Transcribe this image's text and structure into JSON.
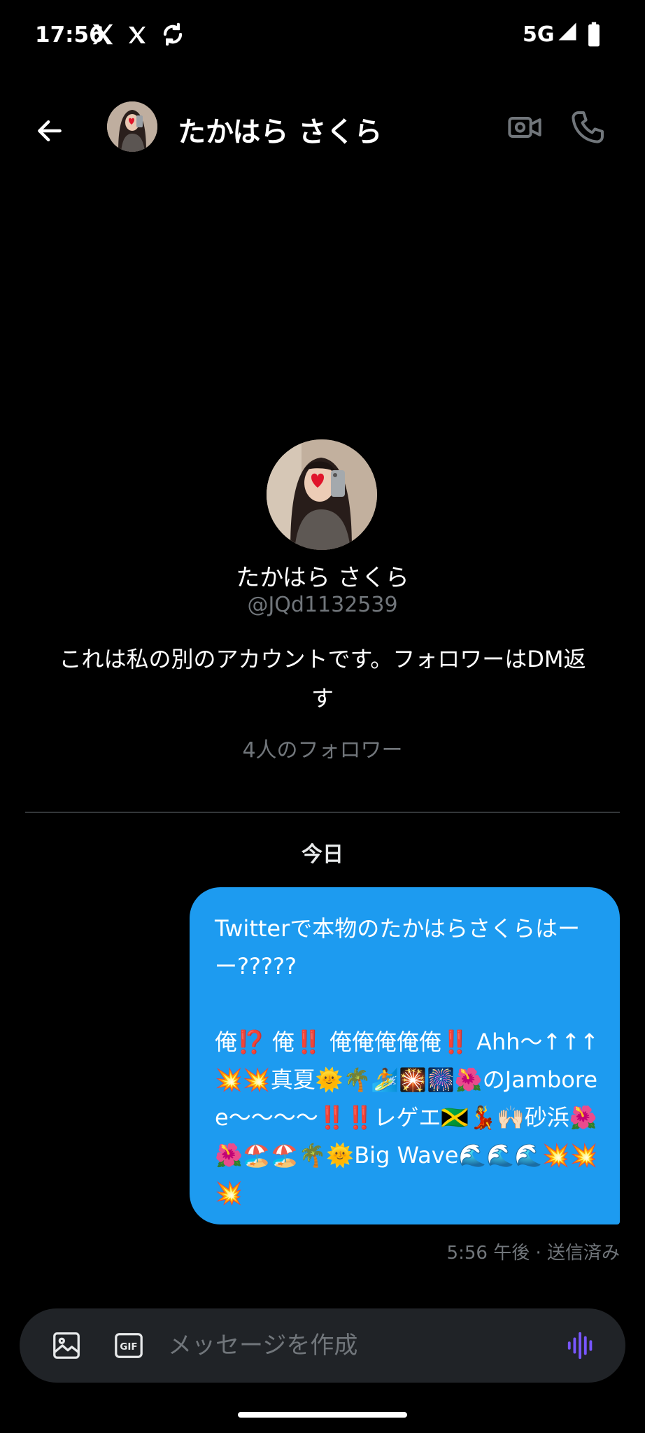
{
  "status_bar": {
    "time": "17:56",
    "network": "5G",
    "icons": [
      "x-logo-icon",
      "x-logo-icon",
      "sync-icon",
      "signal-icon",
      "battery-icon"
    ]
  },
  "header": {
    "name": "たかはら さくら",
    "icons": [
      "back-arrow-icon",
      "video-call-icon",
      "phone-icon"
    ]
  },
  "profile": {
    "name": "たかはら さくら",
    "handle": "@JQd1132539",
    "bio": "これは私の別のアカウントです。フォロワーはDM返す",
    "followers": "4人のフォロワー"
  },
  "conversation": {
    "date_label": "今日",
    "messages": [
      {
        "text": "Twitterで本物のたかはらさくらはーー?????\n\n俺⁉️ 俺‼️ 俺俺俺俺俺‼️ Ahh〜↑↑↑💥💥真夏🌞🌴🏄🎇🎆🌺のJamboree〜〜〜〜‼️‼️レゲエ🇯🇲💃🙌🏻砂浜🌺🌺🏖️🏖️🌴🌞Big Wave🌊🌊🌊💥💥💥",
        "meta": "5:56 午後 · 送信済み",
        "color": "#1d9bf0"
      }
    ]
  },
  "composer": {
    "placeholder": "メッセージを作成",
    "gif_label": "GIF",
    "icons": [
      "image-icon",
      "gif-icon",
      "voice-icon"
    ]
  },
  "colors": {
    "background": "#000000",
    "bubble": "#1d9bf0",
    "secondary_text": "#71767b",
    "accent_voice": "#7856ff"
  }
}
